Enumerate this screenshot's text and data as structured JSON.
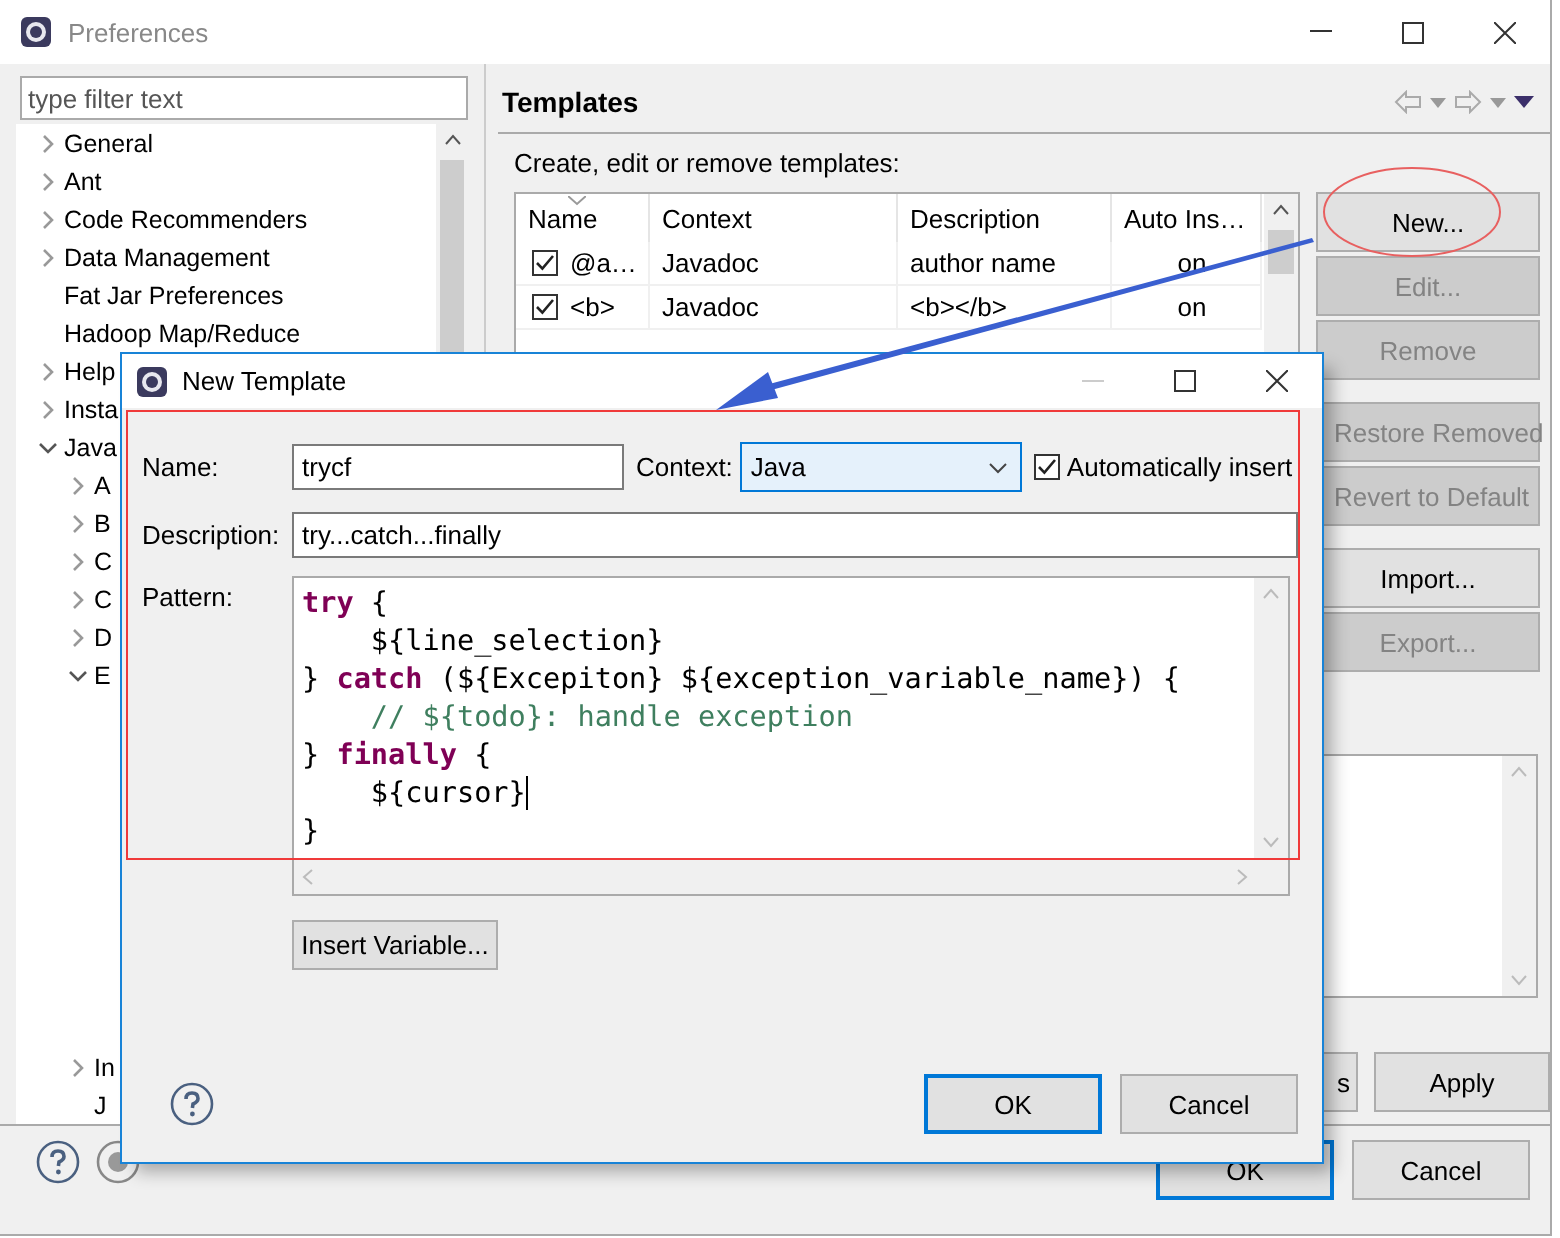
{
  "window": {
    "title": "Preferences"
  },
  "filter": {
    "placeholder": "type filter text"
  },
  "tree": [
    {
      "label": "General",
      "expandable": true,
      "expanded": false
    },
    {
      "label": "Ant",
      "expandable": true,
      "expanded": false
    },
    {
      "label": "Code Recommenders",
      "expandable": true,
      "expanded": false
    },
    {
      "label": "Data Management",
      "expandable": true,
      "expanded": false
    },
    {
      "label": "Fat Jar Preferences",
      "expandable": false
    },
    {
      "label": "Hadoop Map/Reduce",
      "expandable": false
    },
    {
      "label": "Help",
      "expandable": true,
      "expanded": false
    },
    {
      "label": "Insta",
      "expandable": true,
      "expanded": false
    },
    {
      "label": "Java",
      "expandable": true,
      "expanded": true,
      "children": [
        {
          "label": "A",
          "expandable": true,
          "expanded": false
        },
        {
          "label": "B",
          "expandable": true,
          "expanded": false
        },
        {
          "label": "C",
          "expandable": true,
          "expanded": false
        },
        {
          "label": "C",
          "expandable": true,
          "expanded": false
        },
        {
          "label": "D",
          "expandable": true,
          "expanded": false
        },
        {
          "label": "E",
          "expandable": true,
          "expanded": true
        },
        {
          "label": "In",
          "expandable": true,
          "expanded": false
        },
        {
          "label": "J",
          "expandable": false
        }
      ]
    }
  ],
  "page": {
    "title": "Templates",
    "description": "Create, edit or remove templates:"
  },
  "table": {
    "columns": [
      {
        "label": "Name",
        "sorted": true
      },
      {
        "label": "Context",
        "sorted": false
      },
      {
        "label": "Description",
        "sorted": false
      },
      {
        "label": "Auto Ins…",
        "sorted": false
      }
    ],
    "rows": [
      {
        "checked": true,
        "name": "@a…",
        "context": "Javadoc",
        "description": "author name",
        "auto_insert": "on"
      },
      {
        "checked": true,
        "name": "<b>",
        "context": "Javadoc",
        "description": "<b></b>",
        "auto_insert": "on"
      }
    ]
  },
  "side_button_groups": [
    {
      "buttons": [
        {
          "label": "New...",
          "disabled": false
        },
        {
          "label": "Edit...",
          "disabled": true
        },
        {
          "label": "Remove",
          "disabled": true
        }
      ]
    },
    {
      "buttons": [
        {
          "label": "Restore Removed",
          "disabled": true
        },
        {
          "label": "Revert to Default",
          "disabled": true
        }
      ]
    },
    {
      "buttons": [
        {
          "label": "Import...",
          "disabled": false
        },
        {
          "label": "Export...",
          "disabled": true
        }
      ]
    }
  ],
  "page_buttons": [
    {
      "label": "s",
      "clipped": true
    },
    {
      "label": "Apply",
      "clipped": false
    }
  ],
  "footer_buttons": [
    {
      "label": "OK",
      "default": true
    },
    {
      "label": "Cancel",
      "default": false
    }
  ],
  "dialog": {
    "title": "New Template",
    "name_label": "Name:",
    "name": "trycf",
    "context_label": "Context:",
    "context": "Java",
    "auto_insert": {
      "label": "Automatically insert",
      "checked": true
    },
    "description_label": "Description:",
    "description": "try...catch...finally",
    "pattern_label": "Pattern:",
    "pattern": [
      {
        "caret": false,
        "segments": [
          {
            "kind": "keyword",
            "text": "try"
          },
          {
            "kind": "plain",
            "text": " {"
          }
        ]
      },
      {
        "caret": false,
        "segments": [
          {
            "kind": "plain",
            "text": "    ${line_selection}"
          }
        ]
      },
      {
        "caret": false,
        "segments": [
          {
            "kind": "plain",
            "text": "} "
          },
          {
            "kind": "keyword",
            "text": "catch"
          },
          {
            "kind": "plain",
            "text": " (${Excepiton} ${exception_variable_name}) {"
          }
        ]
      },
      {
        "caret": false,
        "segments": [
          {
            "kind": "comment",
            "text": "    // ${todo}: handle exception"
          }
        ]
      },
      {
        "caret": false,
        "segments": [
          {
            "kind": "plain",
            "text": "} "
          },
          {
            "kind": "keyword",
            "text": "finally"
          },
          {
            "kind": "plain",
            "text": " {"
          }
        ]
      },
      {
        "caret": true,
        "segments": [
          {
            "kind": "plain",
            "text": "    ${cursor}"
          }
        ]
      },
      {
        "caret": false,
        "segments": [
          {
            "kind": "plain",
            "text": "}"
          }
        ]
      }
    ],
    "insert_variable": "Insert Variable...",
    "buttons": [
      {
        "label": "OK",
        "default": true
      },
      {
        "label": "Cancel",
        "default": false
      }
    ]
  }
}
